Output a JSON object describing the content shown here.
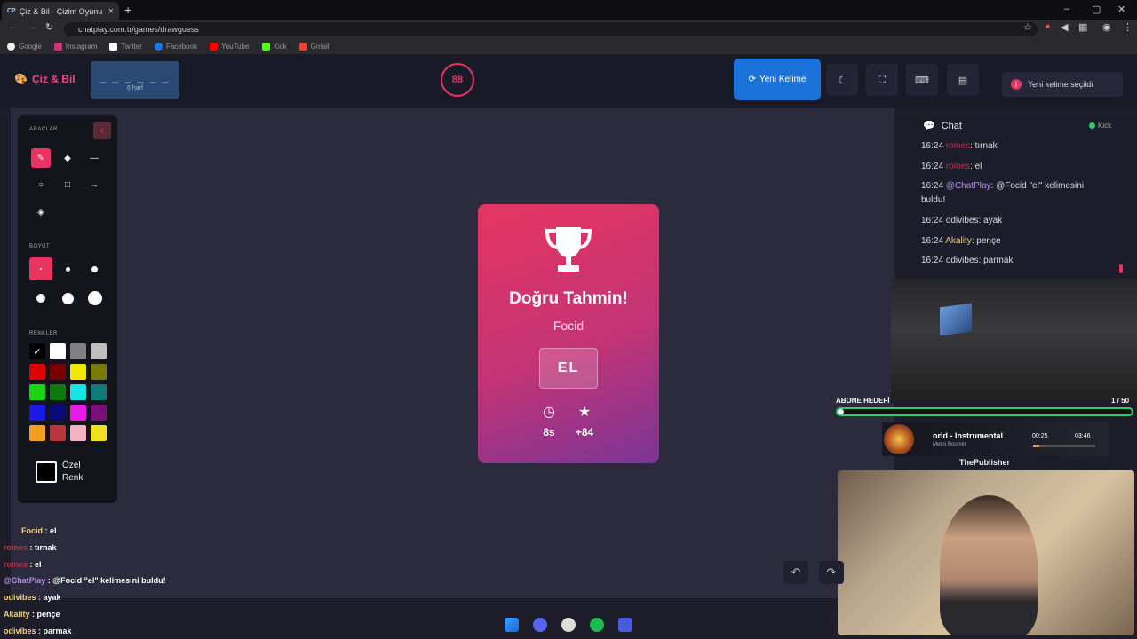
{
  "browser": {
    "tab_title": "Çiz & Bil - Çizim Oyunu",
    "tab_favicon": "CP",
    "url": "chatplay.com.tr/games/drawguess",
    "bookmarks": [
      "Google",
      "Instagram",
      "Twitter",
      "Facebook",
      "YouTube",
      "Kick",
      "Gmail"
    ]
  },
  "header": {
    "logo": "Çiz & Bil",
    "word_hint": "_ _ _ _ _ _",
    "word_letters": "6 harf",
    "timer": "88",
    "new_word": "Yeni Kelime",
    "toast": "Yeni kelime seçildi"
  },
  "tools": {
    "section_tools": "ARAÇLAR",
    "section_size": "BOYUT",
    "section_colors": "RENKLER",
    "custom_color_1": "Özel",
    "custom_color_2": "Renk",
    "colors": [
      "#000000",
      "#ffffff",
      "#808080",
      "#bfbfbf",
      "#e00000",
      "#7a0000",
      "#f1e80a",
      "#7a7a0a",
      "#19d419",
      "#0e7a0e",
      "#12e6e6",
      "#0f7a7a",
      "#1a1ae6",
      "#0a0a7a",
      "#e619e6",
      "#7a0f7a",
      "#f0a01a",
      "#b8353d",
      "#f4b3c3",
      "#f0e020"
    ]
  },
  "result": {
    "title": "Doğru Tahmin!",
    "player": "Focid",
    "word": "EL",
    "time": "8s",
    "points": "+84"
  },
  "chat": {
    "title": "Chat",
    "platform": "Kick",
    "messages": [
      {
        "time": "16:24",
        "user": "roines",
        "text": ": tırnak",
        "color": "#c0304a"
      },
      {
        "time": "16:24",
        "user": "roines",
        "text": ": el",
        "color": "#c0304a"
      },
      {
        "time": "16:24",
        "user": "@ChatPlay",
        "text": ": @Focid \"el\" kelimesini buldu!",
        "color": "#b88ee8"
      },
      {
        "time": "16:24",
        "user": "odivibes",
        "text": ": ayak",
        "color": "#dddddd"
      },
      {
        "time": "16:24",
        "user": "Akality",
        "text": ": pençe",
        "color": "#f0d080"
      },
      {
        "time": "16:24",
        "user": "odivibes",
        "text": ": parmak",
        "color": "#dddddd"
      }
    ]
  },
  "stream": {
    "goal_label": "ABONE HEDEFİ",
    "goal_count": "1 / 50",
    "goal_progress": 0.02,
    "song": "orld - Instrumental",
    "artist": "Metro Boomin",
    "elapsed": "00:25",
    "duration": "03:46",
    "publisher": "ThePublisher"
  },
  "overlay_chat": [
    {
      "user": "Focid",
      "text": " : el",
      "color": "#f0d080"
    },
    {
      "user": "roines",
      "text": " : tırnak",
      "color": "#c0304a"
    },
    {
      "user": "roines",
      "text": " : el",
      "color": "#c0304a"
    },
    {
      "user": "@ChatPlay",
      "text": " : @Focid \"el\" kelimesini buldu!",
      "color": "#b88ee8"
    },
    {
      "user": "odivibes",
      "text": " : ayak",
      "color": "#f0d080"
    },
    {
      "user": "Akality",
      "text": " : pençe",
      "color": "#f0d080"
    },
    {
      "user": "odivibes",
      "text": " : parmak",
      "color": "#f0d080"
    }
  ]
}
